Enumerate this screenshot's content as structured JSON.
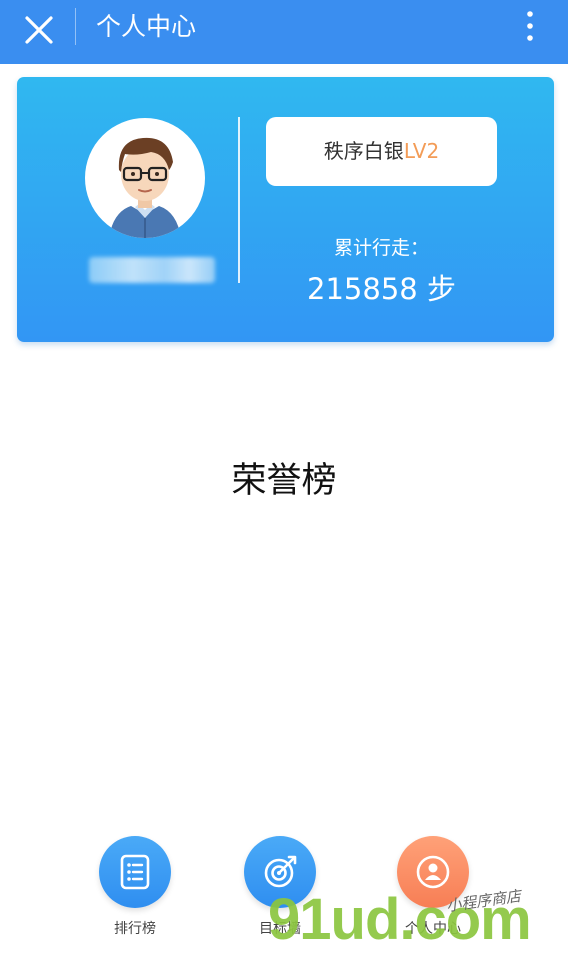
{
  "header": {
    "title": "个人中心"
  },
  "profile": {
    "level_prefix": "秩序白银",
    "level_code": "LV2",
    "steps_label": "累计行走：",
    "steps_value": "215858 步"
  },
  "main": {
    "section_title": "荣誉榜"
  },
  "bottom_nav": [
    {
      "label": "排行榜",
      "icon": "list-icon"
    },
    {
      "label": "目标墙",
      "icon": "target-icon"
    },
    {
      "label": "个人中心",
      "icon": "user-icon"
    }
  ],
  "watermark": {
    "main": "91ud.com",
    "script": "小程序商店"
  },
  "colors": {
    "header": "#3a8ef0",
    "card_top": "#30b8f0",
    "card_bottom": "#3296f4",
    "level_accent": "#f39c57",
    "nav_blue": "#3a9cf5",
    "nav_orange": "#f7885c"
  }
}
